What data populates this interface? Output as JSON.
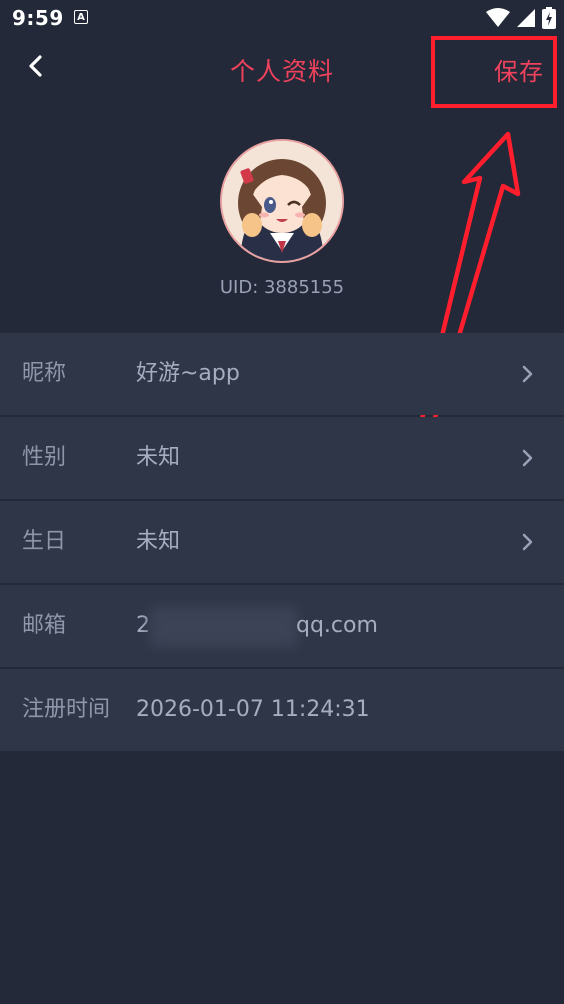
{
  "status_bar": {
    "time": "9:59",
    "notification_icon_letter": "A",
    "icons": [
      "wifi-icon",
      "signal-icon",
      "battery-charging-icon"
    ]
  },
  "header": {
    "back_icon": "chevron-left-icon",
    "title": "个人资料",
    "save_label": "保存",
    "accent_color": "#f0425c"
  },
  "profile": {
    "uid_text": "UID: 3885155"
  },
  "fields": [
    {
      "label": "昵称",
      "value": "好游~app",
      "has_chevron": true
    },
    {
      "label": "性别",
      "value": "未知",
      "has_chevron": true
    },
    {
      "label": "生日",
      "value": "未知",
      "has_chevron": true
    },
    {
      "label": "邮箱",
      "value_prefix": "2",
      "value_suffix": "qq.com",
      "has_chevron": false
    },
    {
      "label": "注册时间",
      "value": "2026-01-07 11:24:31",
      "has_chevron": false
    }
  ],
  "annotation": {
    "highlight_color": "#ff1e2d"
  }
}
